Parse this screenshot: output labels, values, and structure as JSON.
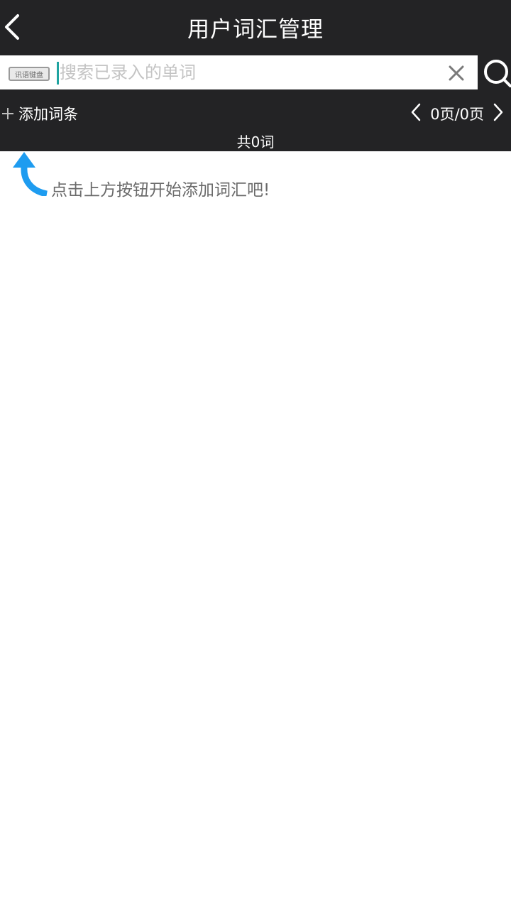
{
  "header": {
    "title": "用户词汇管理",
    "back_icon": "chevron-left-icon"
  },
  "search": {
    "keyboard_badge": "讯语键盘",
    "placeholder": "搜索已录入的单词",
    "value": "",
    "clear_icon": "close-icon",
    "search_icon": "search-icon"
  },
  "toolbar": {
    "add_icon": "plus-icon",
    "add_label": "添加词条",
    "page_text": "0页/0页",
    "prev_icon": "chevron-left-icon",
    "next_icon": "chevron-right-icon",
    "count_text": "共0词"
  },
  "empty_state": {
    "arrow_icon": "curved-arrow-up-icon",
    "hint": "点击上方按钮开始添加词汇吧!"
  },
  "colors": {
    "bar_background": "#232325",
    "accent_blue": "#1e9cf0",
    "caret_teal": "#1fa3a0"
  }
}
